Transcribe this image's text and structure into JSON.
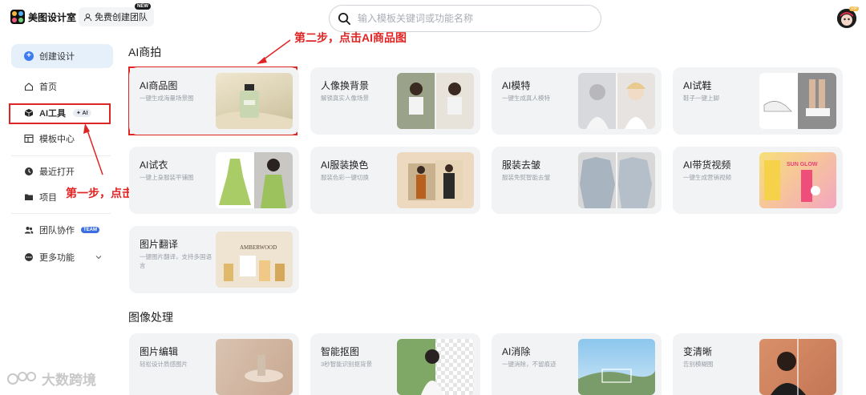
{
  "header": {
    "logo_text": "美图设计室",
    "team_button": "免费创建团队",
    "new_badge": "NEW",
    "search_placeholder": "输入模板关键词或功能名称",
    "vip_badge": "VIP"
  },
  "sidebar": {
    "create": "创建设计",
    "home": "首页",
    "ai_tools": "AI工具",
    "ai_tag": "✦ AI",
    "templates": "模板中心",
    "recent": "最近打开",
    "projects": "项目",
    "team": "团队协作",
    "team_tag": "TEAM",
    "more": "更多功能"
  },
  "annotations": {
    "step1": "第一步，点击AI工具栏",
    "step2": "第二步，点击AI商品图"
  },
  "sections": {
    "ai_shoot": "AI商拍",
    "image_processing": "图像处理"
  },
  "cards": [
    {
      "name": "AI商品图",
      "desc": "一键生成海量场景图"
    },
    {
      "name": "人像换背景",
      "desc": "解锁真实人像场景"
    },
    {
      "name": "AI模特",
      "desc": "一键生成真人模特"
    },
    {
      "name": "AI试鞋",
      "desc": "鞋子一键上脚"
    },
    {
      "name": "AI试衣",
      "desc": "一键上身服装平铺图"
    },
    {
      "name": "AI服装换色",
      "desc": "服装色彩一键切换"
    },
    {
      "name": "服装去皱",
      "desc": "服装免熨智能去皱"
    },
    {
      "name": "AI带货视频",
      "desc": "一键生成营销视频"
    },
    {
      "name": "图片翻译",
      "desc": "一键图片翻译，支持多国语言"
    },
    {
      "name": "图片编辑",
      "desc": "轻松设计质感图片"
    },
    {
      "name": "智能抠图",
      "desc": "3秒智能识别抠背景"
    },
    {
      "name": "AI消除",
      "desc": "一键消除，不留痕迹"
    },
    {
      "name": "变清晰",
      "desc": "告别模糊图"
    }
  ],
  "thumb_text": {
    "perfume_brand": "AMBERWOOD",
    "glow": "SUN GLOW"
  },
  "watermark": "大数跨境"
}
